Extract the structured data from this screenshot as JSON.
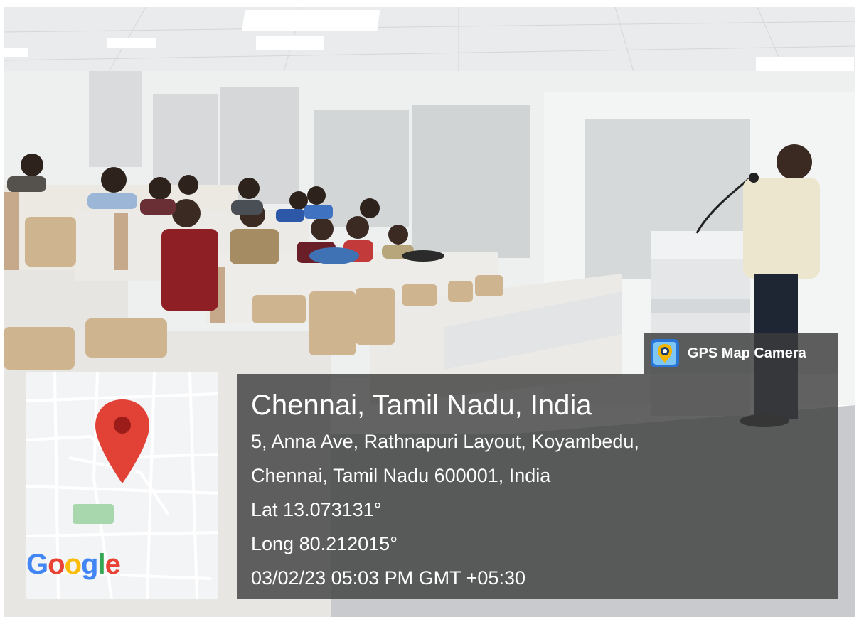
{
  "overlay": {
    "app_name": "GPS Map Camera",
    "app_icon": "camera-pin-icon",
    "city": "Chennai, Tamil Nadu, India",
    "address_line1": "5, Anna Ave, Rathnapuri Layout, Koyambedu,",
    "address_line2": "Chennai, Tamil Nadu 600001, India",
    "latitude": "Lat 13.073131°",
    "longitude": "Long 80.212015°",
    "datetime": "03/02/23 05:03 PM GMT +05:30"
  },
  "map": {
    "brand": "Google",
    "pin_icon": "map-pin-icon",
    "brand_colors": [
      "#4285F4",
      "#EA4335",
      "#FBBC05",
      "#4285F4",
      "#34A853",
      "#EA4335"
    ]
  },
  "scene": {
    "description_icons": [
      "ceiling-light-icon",
      "window-blind-icon",
      "podium-icon",
      "microphone-icon"
    ]
  }
}
